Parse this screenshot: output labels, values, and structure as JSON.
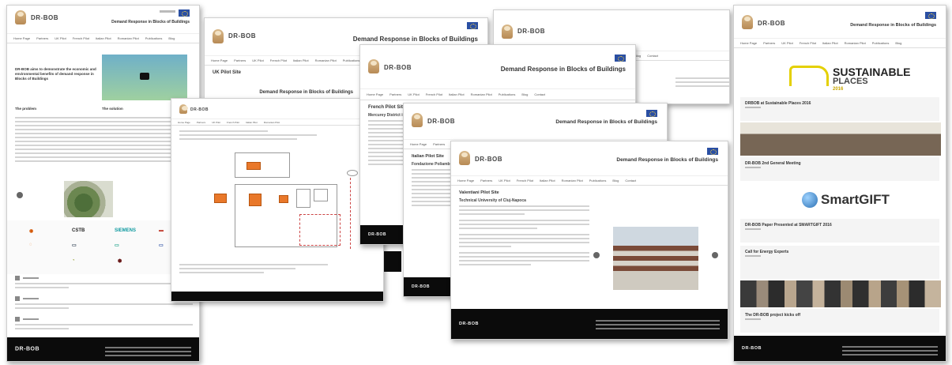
{
  "site": {
    "brand": "DR-BOB",
    "tagline": "Demand Response in Blocks of Buildings",
    "nav": [
      "Home Page",
      "Partners",
      "UK Pilot",
      "French Pilot",
      "Italian Pilot",
      "Romanian Pilot",
      "Publications",
      "Blog",
      "Contact"
    ]
  },
  "shot1": {
    "intro": "DR-BOB aims to demonstrate the economic and environmental benefits of demand response in Blocks of Buildings",
    "col1_title": "The problem",
    "col2_title": "The solution",
    "partners": [
      "CSTB",
      "SIEMENS"
    ]
  },
  "shot3": {
    "page_title": "UK Pilot Site"
  },
  "shot4": {
    "page_title": "French Pilot Site",
    "section_title": "Mercurey District in A"
  },
  "shot5": {
    "page_title": "Italian Pilot Site",
    "section_title": "Fondazione Poliambulanza"
  },
  "shot6": {
    "page_title": "Valentiani Pilot Site",
    "section_title": "Technical University of Cluj-Napoca"
  },
  "shot7": {
    "sustainable": [
      "SUSTAINABLE",
      "PLACES"
    ],
    "sustainable_year": "2016",
    "smartgift": "SmartGIFT",
    "cards": [
      "DRBOB at Sustainable Places 2016",
      "DR-BOB 2nd General Meeting",
      "DR-BOB Paper Presented at SMARTGIFT 2016",
      "Call for Energy Experts",
      "The DR-BOB project kicks off"
    ]
  },
  "colors": {
    "accent_orange": "#e9782a",
    "footer": "#0b0b0b",
    "eu_blue": "#2a4fa3"
  }
}
